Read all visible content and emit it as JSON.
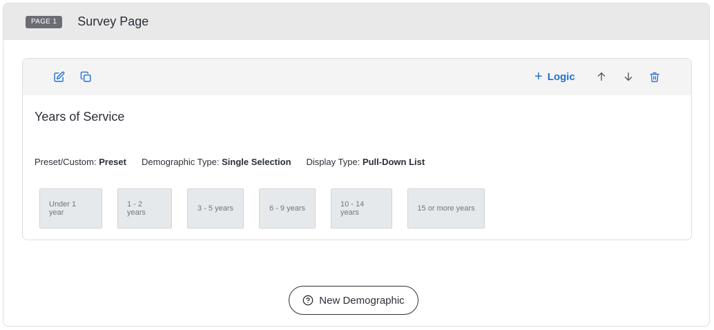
{
  "page": {
    "badge": "PAGE 1",
    "title": "Survey Page"
  },
  "toolbar": {
    "logic_label": "Logic",
    "icons": [
      "edit-icon",
      "copy-icon",
      "plus-icon",
      "arrow-up-icon",
      "arrow-down-icon",
      "trash-icon"
    ]
  },
  "question": {
    "title": "Years of Service",
    "meta": [
      {
        "label": "Preset/Custom:",
        "value": "Preset"
      },
      {
        "label": "Demographic Type:",
        "value": "Single Selection"
      },
      {
        "label": "Display Type:",
        "value": "Pull-Down List"
      }
    ],
    "options": [
      "Under 1 year",
      "1 - 2 years",
      "3 - 5 years",
      "6 - 9 years",
      "10 - 14 years",
      "15 or more years"
    ]
  },
  "footer": {
    "new_demographic_label": "New Demographic"
  },
  "colors": {
    "accent": "#1f6fd1",
    "header_bg": "#e9e9ea",
    "badge_bg": "#6b6d73",
    "option_bg": "#e6e9ec"
  }
}
